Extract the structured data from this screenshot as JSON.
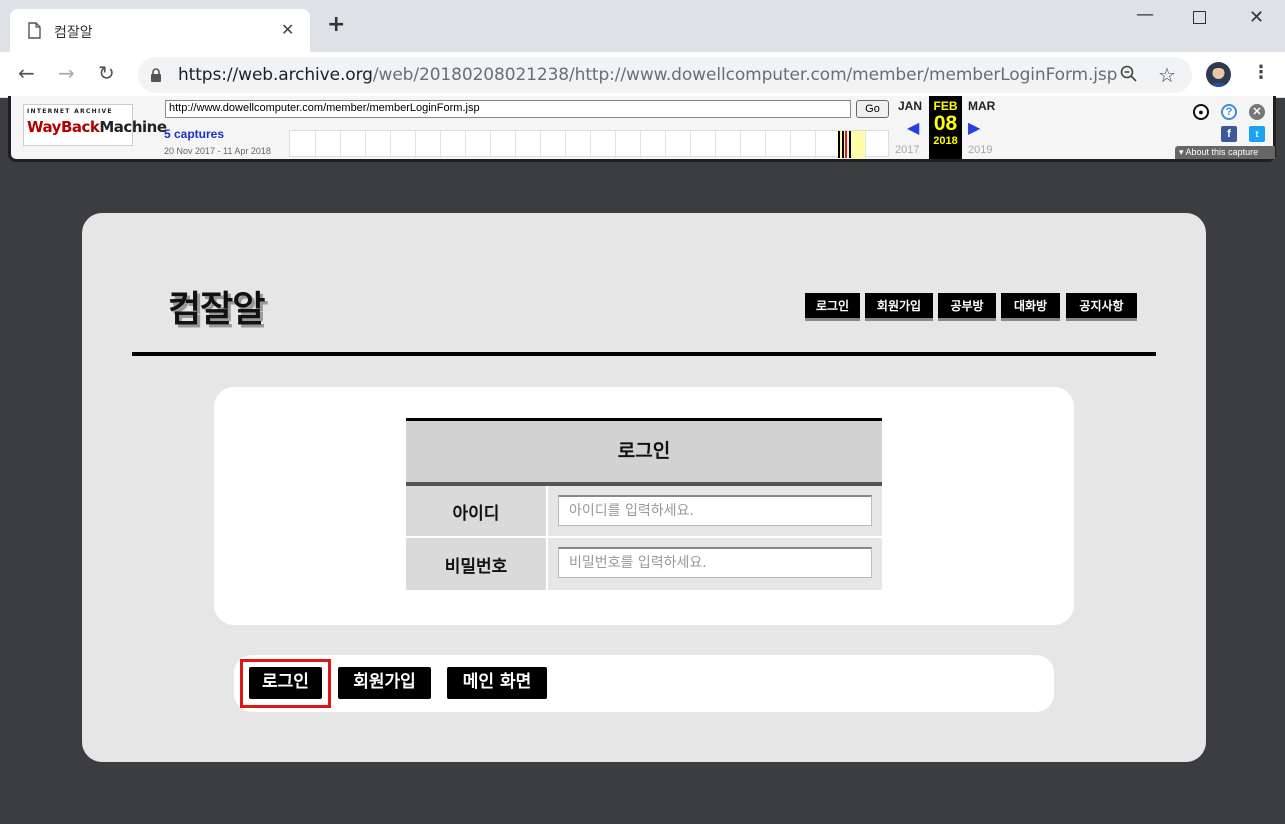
{
  "browser": {
    "tab_title": "컴잘알",
    "url_host": "https://web.archive.org",
    "url_path": "/web/20180208021238/http://www.dowellcomputer.com/member/memberLoginForm.jsp"
  },
  "wayback": {
    "logo_top": "INTERNET ARCHIVE",
    "logo_left": "WayBack",
    "logo_right": "Machine",
    "url": "http://www.dowellcomputer.com/member/memberLoginForm.jsp",
    "go_label": "Go",
    "captures": "5 captures",
    "range": "20 Nov 2017 - 11 Apr 2018",
    "prev_month": "JAN",
    "cur_month": "FEB",
    "next_month": "MAR",
    "day": "08",
    "prev_year": "2017",
    "cur_year": "2018",
    "next_year": "2019",
    "about": "About this capture"
  },
  "site": {
    "logo": "컴잘알",
    "nav": [
      "로그인",
      "회원가입",
      "공부방",
      "대화방",
      "공지사항"
    ]
  },
  "login_form": {
    "title": "로그인",
    "id_label": "아이디",
    "id_placeholder": "아이디를 입력하세요.",
    "pw_label": "비밀번호",
    "pw_placeholder": "비밀번호를 입력하세요."
  },
  "actions": {
    "login": "로그인",
    "signup": "회원가입",
    "main": "메인 화면"
  },
  "colors": {
    "highlight": "#e01616",
    "accent_black": "#000000"
  }
}
